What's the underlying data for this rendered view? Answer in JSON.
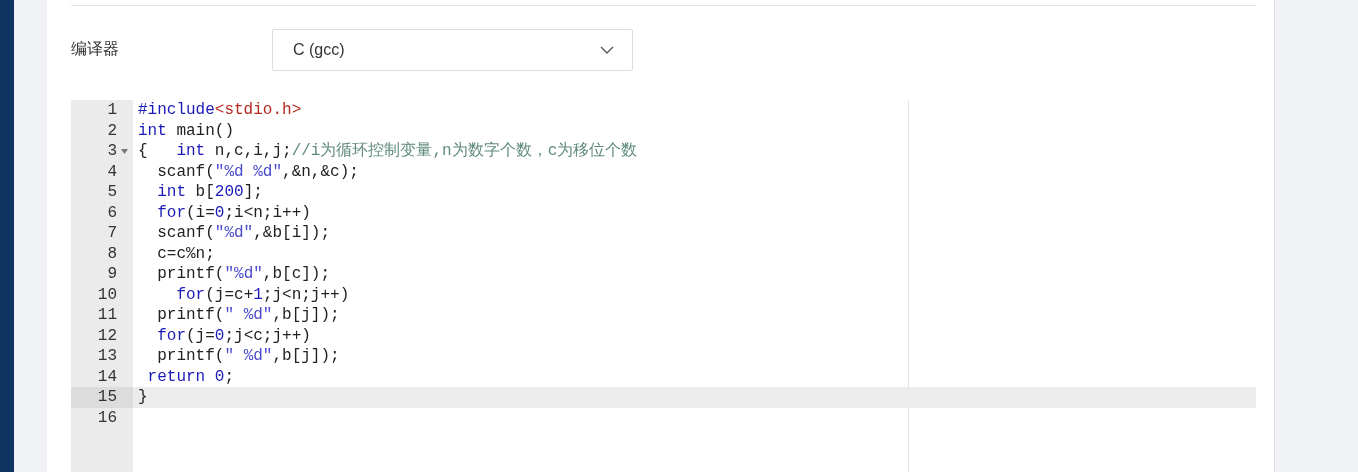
{
  "compiler": {
    "label": "编译器",
    "value": "C (gcc)"
  },
  "editor": {
    "lines": [
      {
        "number": "1",
        "selected": false,
        "tokens": [
          {
            "kind": "directive",
            "text": "#include"
          },
          {
            "kind": "header",
            "text": "<stdio.h>"
          }
        ]
      },
      {
        "number": "2",
        "selected": false,
        "tokens": [
          {
            "kind": "keyword",
            "text": "int"
          },
          {
            "kind": "plain",
            "text": " main()"
          }
        ]
      },
      {
        "number": "3",
        "selected": false,
        "foldable": true,
        "tokens": [
          {
            "kind": "plain",
            "text": "{   "
          },
          {
            "kind": "keyword",
            "text": "int"
          },
          {
            "kind": "plain",
            "text": " n,c,i,j;"
          },
          {
            "kind": "comment",
            "text": "//i为循环控制变量,n为数字个数，c为移位个数"
          }
        ]
      },
      {
        "number": "4",
        "selected": false,
        "tokens": [
          {
            "kind": "plain",
            "text": "  scanf("
          },
          {
            "kind": "string",
            "text": "\"%d %d\""
          },
          {
            "kind": "plain",
            "text": ",&n,&c);"
          }
        ]
      },
      {
        "number": "5",
        "selected": false,
        "tokens": [
          {
            "kind": "keyword",
            "text": "  int"
          },
          {
            "kind": "plain",
            "text": " b["
          },
          {
            "kind": "number",
            "text": "200"
          },
          {
            "kind": "plain",
            "text": "];"
          }
        ]
      },
      {
        "number": "6",
        "selected": false,
        "tokens": [
          {
            "kind": "keyword",
            "text": "  for"
          },
          {
            "kind": "plain",
            "text": "(i="
          },
          {
            "kind": "number",
            "text": "0"
          },
          {
            "kind": "plain",
            "text": ";i<n;i++)"
          }
        ]
      },
      {
        "number": "7",
        "selected": false,
        "tokens": [
          {
            "kind": "plain",
            "text": "  scanf("
          },
          {
            "kind": "string",
            "text": "\"%d\""
          },
          {
            "kind": "plain",
            "text": ",&b[i]);"
          }
        ]
      },
      {
        "number": "8",
        "selected": false,
        "tokens": [
          {
            "kind": "plain",
            "text": "  c=c%n;"
          }
        ]
      },
      {
        "number": "9",
        "selected": false,
        "tokens": [
          {
            "kind": "plain",
            "text": "  printf("
          },
          {
            "kind": "string",
            "text": "\"%d\""
          },
          {
            "kind": "plain",
            "text": ",b[c]);"
          }
        ]
      },
      {
        "number": "10",
        "selected": false,
        "tokens": [
          {
            "kind": "keyword",
            "text": "    for"
          },
          {
            "kind": "plain",
            "text": "(j=c+"
          },
          {
            "kind": "number",
            "text": "1"
          },
          {
            "kind": "plain",
            "text": ";j<n;j++)"
          }
        ]
      },
      {
        "number": "11",
        "selected": false,
        "tokens": [
          {
            "kind": "plain",
            "text": "  printf("
          },
          {
            "kind": "string",
            "text": "\" %d\""
          },
          {
            "kind": "plain",
            "text": ",b[j]);"
          }
        ]
      },
      {
        "number": "12",
        "selected": false,
        "tokens": [
          {
            "kind": "keyword",
            "text": "  for"
          },
          {
            "kind": "plain",
            "text": "(j="
          },
          {
            "kind": "number",
            "text": "0"
          },
          {
            "kind": "plain",
            "text": ";j<c;j++)"
          }
        ]
      },
      {
        "number": "13",
        "selected": false,
        "tokens": [
          {
            "kind": "plain",
            "text": "  printf("
          },
          {
            "kind": "string",
            "text": "\" %d\""
          },
          {
            "kind": "plain",
            "text": ",b[j]);"
          }
        ]
      },
      {
        "number": "14",
        "selected": false,
        "tokens": [
          {
            "kind": "keyword",
            "text": " return"
          },
          {
            "kind": "number",
            "text": " 0"
          },
          {
            "kind": "plain",
            "text": ";"
          }
        ]
      },
      {
        "number": "15",
        "selected": true,
        "tokens": [
          {
            "kind": "plain",
            "text": "}"
          }
        ]
      },
      {
        "number": "16",
        "selected": false
      }
    ]
  }
}
